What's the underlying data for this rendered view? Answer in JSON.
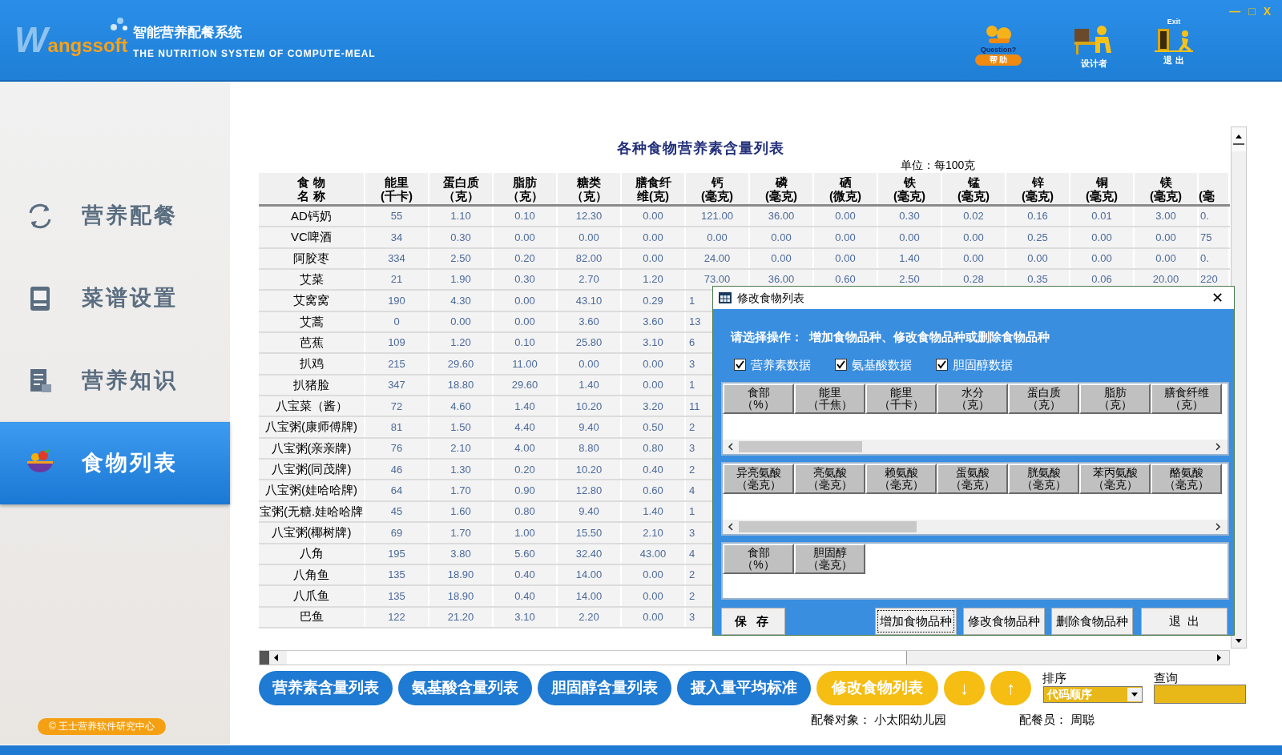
{
  "header": {
    "logo_initial": "W",
    "logo_text": "angssoft",
    "title": "智能营养配餐系统",
    "subtitle": "THE NUTRITION SYSTEM OF COMPUTE-MEAL",
    "tools": [
      {
        "kind": "help",
        "caption": "Question?",
        "label": "帮 助"
      },
      {
        "kind": "designer",
        "label": "设计者"
      },
      {
        "kind": "exit",
        "caption": "Exit",
        "label": "退 出"
      }
    ],
    "window_controls": [
      "—",
      "□",
      "X"
    ]
  },
  "sidebar": {
    "items": [
      {
        "label": "营养配餐",
        "kind": "cycle",
        "selected": false
      },
      {
        "label": "菜谱设置",
        "kind": "book",
        "selected": false
      },
      {
        "label": "营养知识",
        "kind": "notes",
        "selected": false
      },
      {
        "label": "食物列表",
        "kind": "bowl",
        "selected": true
      }
    ],
    "copyright": "© 王士营养软件研究中心"
  },
  "table": {
    "title": "各种食物营养素含量列表",
    "unit": "单位：每100克",
    "columns": [
      [
        "食 物",
        "名 称"
      ],
      [
        "能里",
        "(千卡)"
      ],
      [
        "蛋白质",
        "（克）"
      ],
      [
        "脂肪",
        "（克）"
      ],
      [
        "糖类",
        "（克）"
      ],
      [
        "膳食纤",
        "维(克)"
      ],
      [
        "钙",
        "(毫克)"
      ],
      [
        "磷",
        "(毫克)"
      ],
      [
        "硒",
        "(微克)"
      ],
      [
        "铁",
        "(毫克)"
      ],
      [
        "锰",
        "(毫克)"
      ],
      [
        "锌",
        "(毫克)"
      ],
      [
        "铜",
        "(毫克)"
      ],
      [
        "镁",
        "(毫克)"
      ],
      [
        "(毫"
      ]
    ],
    "rows": [
      {
        "name": "AD钙奶",
        "values": [
          "55",
          "1.10",
          "0.10",
          "12.30",
          "0.00",
          "121.00",
          "36.00",
          "0.00",
          "0.30",
          "0.02",
          "0.16",
          "0.01",
          "3.00",
          "0."
        ]
      },
      {
        "name": "VC啤酒",
        "values": [
          "34",
          "0.30",
          "0.00",
          "0.00",
          "0.00",
          "0.00",
          "0.00",
          "0.00",
          "0.00",
          "0.00",
          "0.25",
          "0.00",
          "0.00",
          "75"
        ]
      },
      {
        "name": "阿胶枣",
        "values": [
          "334",
          "2.50",
          "0.20",
          "82.00",
          "0.00",
          "24.00",
          "0.00",
          "0.00",
          "1.40",
          "0.00",
          "0.00",
          "0.00",
          "0.00",
          "0."
        ]
      },
      {
        "name": "艾菜",
        "values": [
          "21",
          "1.90",
          "0.30",
          "2.70",
          "1.20",
          "73.00",
          "36.00",
          "0.60",
          "2.50",
          "0.28",
          "0.35",
          "0.06",
          "20.00",
          "220"
        ]
      },
      {
        "name": "艾窝窝",
        "values": [
          "190",
          "4.30",
          "0.00",
          "43.10",
          "0.29",
          "1"
        ]
      },
      {
        "name": "艾蒿",
        "values": [
          "0",
          "0.00",
          "0.00",
          "3.60",
          "3.60",
          "13"
        ]
      },
      {
        "name": "芭蕉",
        "values": [
          "109",
          "1.20",
          "0.10",
          "25.80",
          "3.10",
          "6"
        ]
      },
      {
        "name": "扒鸡",
        "values": [
          "215",
          "29.60",
          "11.00",
          "0.00",
          "0.00",
          "3"
        ]
      },
      {
        "name": "扒猪脸",
        "values": [
          "347",
          "18.80",
          "29.60",
          "1.40",
          "0.00",
          "1"
        ]
      },
      {
        "name": "八宝菜（酱）",
        "values": [
          "72",
          "4.60",
          "1.40",
          "10.20",
          "3.20",
          "11"
        ]
      },
      {
        "name": "八宝粥(康师傅牌)",
        "values": [
          "81",
          "1.50",
          "4.40",
          "9.40",
          "0.50",
          "2"
        ]
      },
      {
        "name": "八宝粥(亲亲牌)",
        "values": [
          "76",
          "2.10",
          "4.00",
          "8.80",
          "0.80",
          "3"
        ]
      },
      {
        "name": "八宝粥(同茂牌)",
        "values": [
          "46",
          "1.30",
          "0.20",
          "10.20",
          "0.40",
          "2"
        ]
      },
      {
        "name": "八宝粥(娃哈哈牌)",
        "values": [
          "64",
          "1.70",
          "0.90",
          "12.80",
          "0.60",
          "4"
        ]
      },
      {
        "name": "宝粥(无糖.娃哈哈牌",
        "values": [
          "45",
          "1.60",
          "0.80",
          "9.40",
          "1.40",
          "1"
        ]
      },
      {
        "name": "八宝粥(椰树牌)",
        "values": [
          "69",
          "1.70",
          "1.00",
          "15.50",
          "2.10",
          "3"
        ]
      },
      {
        "name": "八角",
        "values": [
          "195",
          "3.80",
          "5.60",
          "32.40",
          "43.00",
          "4"
        ]
      },
      {
        "name": "八角鱼",
        "values": [
          "135",
          "18.90",
          "0.40",
          "14.00",
          "0.00",
          "2"
        ]
      },
      {
        "name": "八爪鱼",
        "values": [
          "135",
          "18.90",
          "0.40",
          "14.00",
          "0.00",
          "2"
        ]
      },
      {
        "name": "巴鱼",
        "values": [
          "122",
          "21.20",
          "3.10",
          "2.20",
          "0.00",
          "3"
        ]
      }
    ]
  },
  "dialog": {
    "title": "修改食物列表",
    "close": "✕",
    "prompt": "请选择操作：  增加食物品种、修改食物品种或删除食物品种",
    "checkboxes": [
      {
        "label": "营养素数据",
        "checked": true
      },
      {
        "label": "氨基酸数据",
        "checked": true
      },
      {
        "label": "胆固醇数据",
        "checked": true
      }
    ],
    "grids": [
      {
        "scroll": true,
        "columns": [
          [
            "食部",
            "（%）"
          ],
          [
            "能里",
            "（千焦）"
          ],
          [
            "能里",
            "（千卡）"
          ],
          [
            "水分",
            "（克）"
          ],
          [
            "蛋白质",
            "（克）"
          ],
          [
            "脂肪",
            "（克）"
          ],
          [
            "膳食纤维",
            "（克）"
          ]
        ]
      },
      {
        "scroll": true,
        "columns": [
          [
            "异亮氨酸",
            "（毫克）"
          ],
          [
            "亮氨酸",
            "（毫克）"
          ],
          [
            "赖氨酸",
            "（毫克）"
          ],
          [
            "蛋氨酸",
            "（毫克）"
          ],
          [
            "胱氨酸",
            "（毫克）"
          ],
          [
            "苯丙氨酸",
            "（毫克）"
          ],
          [
            "酪氨酸",
            "（毫克）"
          ]
        ]
      },
      {
        "scroll": false,
        "columns": [
          [
            "食部",
            "（%）"
          ],
          [
            "胆固醇",
            "（毫克）"
          ]
        ]
      }
    ],
    "buttons": [
      {
        "label": "保 存",
        "kind": "save",
        "focused": false
      },
      {
        "label": "增加食物品种",
        "kind": "action",
        "focused": true
      },
      {
        "label": "修改食物品种",
        "kind": "action",
        "focused": false
      },
      {
        "label": "删除食物品种",
        "kind": "action",
        "focused": false
      },
      {
        "label": "退  出",
        "kind": "action",
        "focused": false
      }
    ]
  },
  "toolbar": {
    "buttons": [
      {
        "label": "营养素含量列表",
        "kind": "blue"
      },
      {
        "label": "氨基酸含量列表",
        "kind": "blue"
      },
      {
        "label": "胆固醇含量列表",
        "kind": "blue"
      },
      {
        "label": "摄入量平均标准",
        "kind": "blue"
      },
      {
        "label": "修改食物列表",
        "kind": "yellow"
      },
      {
        "label": "↓",
        "kind": "arrow"
      },
      {
        "label": "↑",
        "kind": "arrow"
      }
    ],
    "sort_label": "排序",
    "sort_value": "代码顺序",
    "search_label": "查询"
  },
  "info": [
    {
      "label": "配餐对象：",
      "value": "小太阳幼儿园"
    },
    {
      "label": "配餐员：",
      "value": "周聪"
    }
  ]
}
